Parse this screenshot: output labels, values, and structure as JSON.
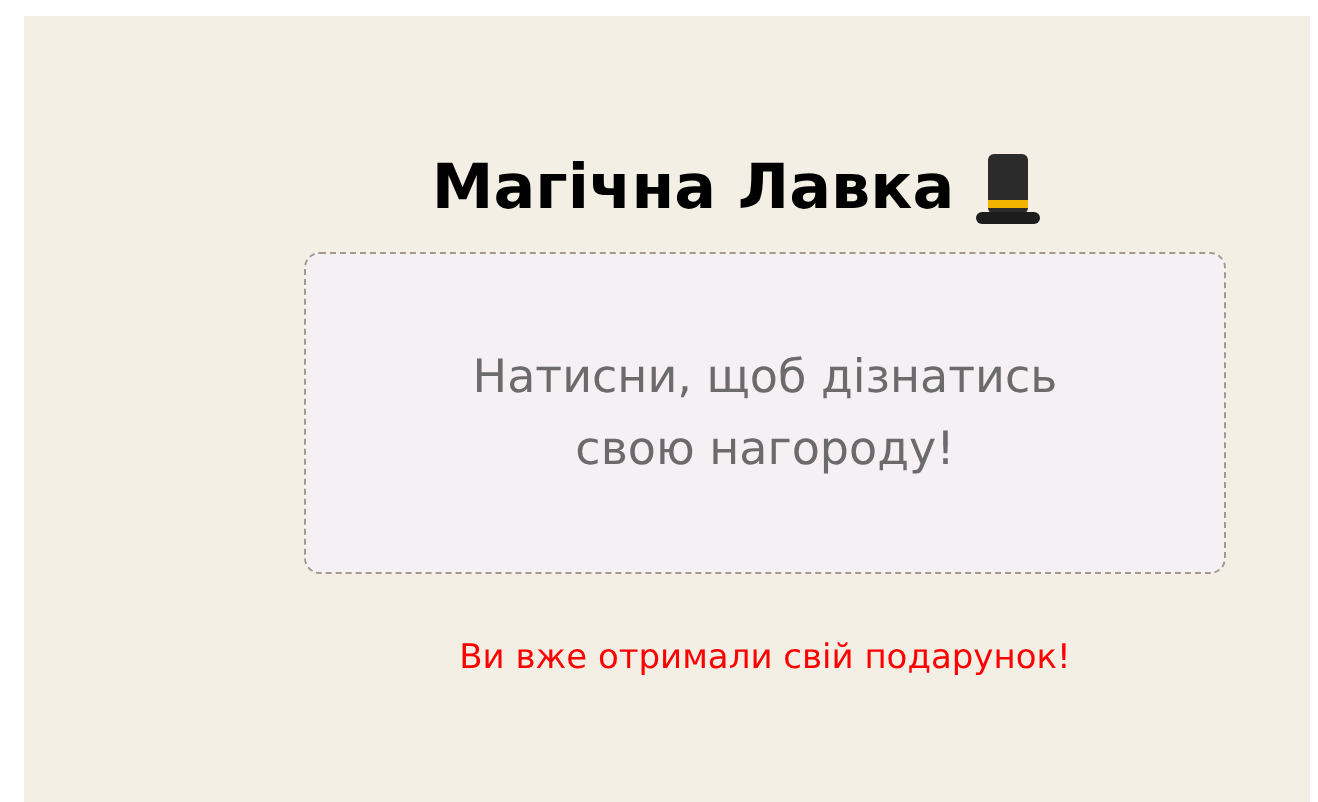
{
  "title": "Магічна Лавка",
  "reveal_card": {
    "text": "Натисни, щоб дізнатись свою нагороду!"
  },
  "message": {
    "text": "Ви вже отримали свій подарунок!",
    "kind": "error"
  }
}
